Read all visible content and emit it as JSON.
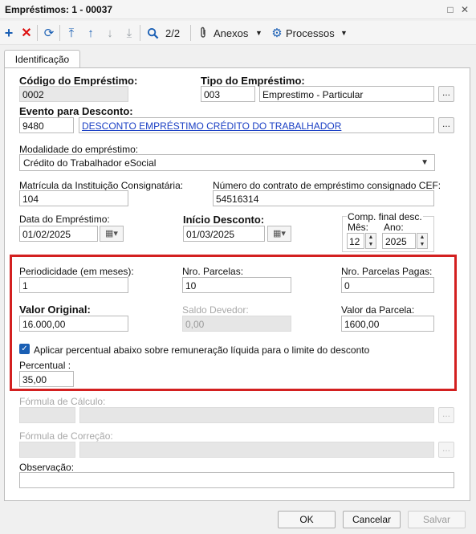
{
  "window": {
    "title": "Empréstimos: 1 - 00037",
    "minimize_glyph": "□",
    "close_glyph": "✕"
  },
  "toolbar": {
    "record_counter": "2/2",
    "anexos_label": "Anexos",
    "processos_label": "Processos",
    "icons": [
      "add-icon",
      "delete-icon",
      "refresh-icon",
      "first-record-icon",
      "previous-record-icon",
      "next-record-icon",
      "last-record-icon",
      "search-icon",
      "paperclip-icon",
      "gear-icon"
    ]
  },
  "tabs": [
    {
      "label": "Identificação"
    }
  ],
  "form": {
    "codigo_emprestimo": {
      "label": "Código do Empréstimo:",
      "value": "0002"
    },
    "tipo_emprestimo": {
      "label": "Tipo do Empréstimo:",
      "code": "003",
      "description": "Emprestimo - Particular"
    },
    "evento_desconto": {
      "label": "Evento para Desconto:",
      "code": "9480",
      "description": "DESCONTO EMPRÉSTIMO CRÉDITO DO TRABALHADOR"
    },
    "modalidade": {
      "label": "Modalidade do empréstimo:",
      "selected": "Crédito do Trabalhador eSocial"
    },
    "matricula": {
      "label": "Matrícula da Instituição Consignatária:",
      "value": "104"
    },
    "numero_contrato": {
      "label": "Número do contrato de empréstimo consignado CEF:",
      "value": "54516314"
    },
    "data_emprestimo": {
      "label": "Data do Empréstimo:",
      "value": "01/02/2025"
    },
    "inicio_desconto": {
      "label": "Início Desconto:",
      "value": "01/03/2025"
    },
    "comp_final": {
      "label": "Comp. final desc.",
      "mes_label": "Mês:",
      "mes": "12",
      "ano_label": "Ano:",
      "ano": "2025"
    },
    "periodicidade": {
      "label": "Periodicidade (em meses):",
      "value": "1"
    },
    "nro_parcelas": {
      "label": "Nro. Parcelas:",
      "value": "10"
    },
    "nro_parcelas_pagas": {
      "label": "Nro. Parcelas Pagas:",
      "value": "0"
    },
    "valor_original": {
      "label": "Valor Original:",
      "value": "16.000,00"
    },
    "saldo_devedor": {
      "label": "Saldo Devedor:",
      "value": "0,00"
    },
    "valor_parcela": {
      "label": "Valor da Parcela:",
      "value": "1600,00"
    },
    "aplicar_percentual": {
      "label": "Aplicar percentual abaixo sobre remuneração líquida para o limite do desconto",
      "checked": true
    },
    "percentual": {
      "label": "Percentual :",
      "value": "35,00"
    },
    "formula_calculo": {
      "label": "Fórmula de Cálculo:",
      "code": "",
      "description": ""
    },
    "formula_correcao": {
      "label": "Fórmula de Correção:",
      "code": "",
      "description": ""
    },
    "observacao": {
      "label": "Observação:",
      "value": ""
    }
  },
  "lookup_button_label": "...",
  "buttons": {
    "ok": "OK",
    "cancel": "Cancelar",
    "save": "Salvar"
  },
  "colors": {
    "accent": "#1a5fb4",
    "highlight": "#d32020",
    "link": "#1a3fc4"
  }
}
